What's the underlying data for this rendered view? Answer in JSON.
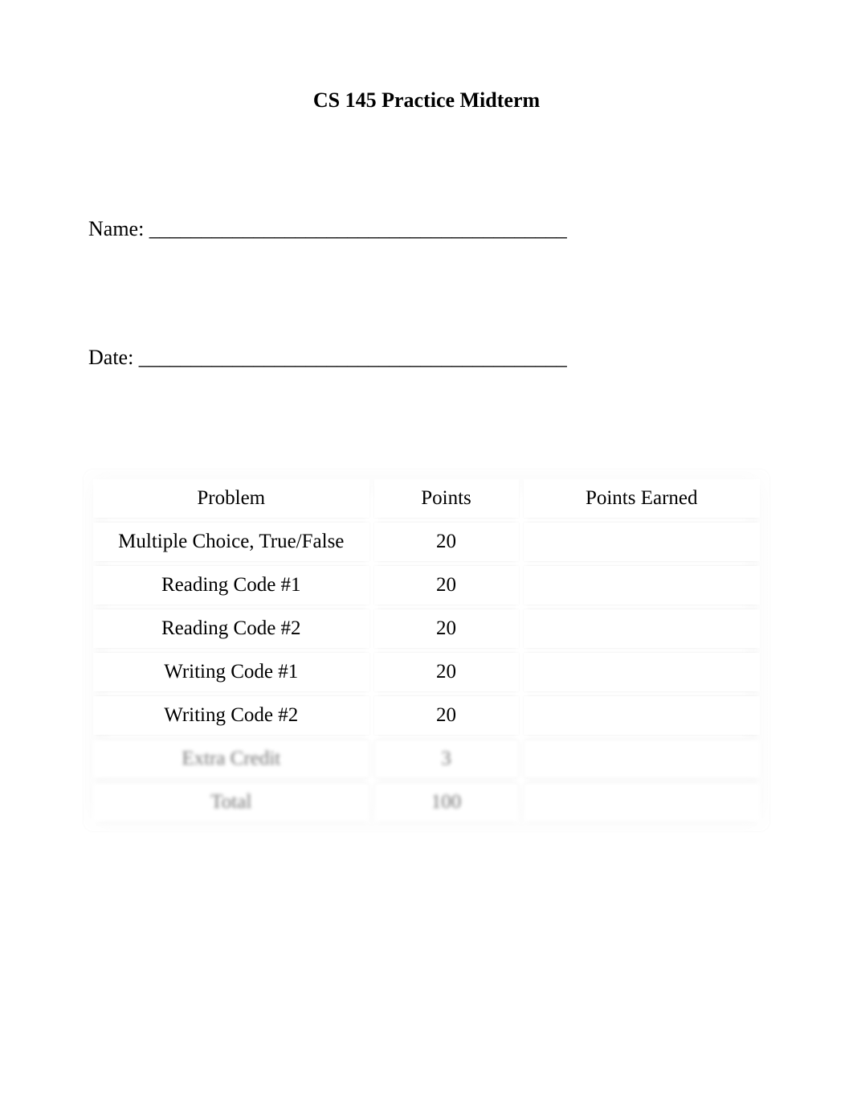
{
  "title": "CS 145 Practice Midterm",
  "fields": {
    "name": "Name: ________________________________________",
    "date": "Date: _________________________________________"
  },
  "table": {
    "headers": {
      "problem": "Problem",
      "points": "Points",
      "earned": "Points Earned"
    },
    "rows": [
      {
        "problem": "Multiple Choice, True/False",
        "points": "20",
        "earned": ""
      },
      {
        "problem": "Reading Code #1",
        "points": "20",
        "earned": ""
      },
      {
        "problem": "Reading Code #2",
        "points": "20",
        "earned": ""
      },
      {
        "problem": "Writing Code #1",
        "points": "20",
        "earned": ""
      },
      {
        "problem": "Writing Code #2",
        "points": "20",
        "earned": ""
      },
      {
        "problem": "Extra Credit",
        "points": "3",
        "earned": ""
      },
      {
        "problem": "Total",
        "points": "100",
        "earned": ""
      }
    ]
  }
}
